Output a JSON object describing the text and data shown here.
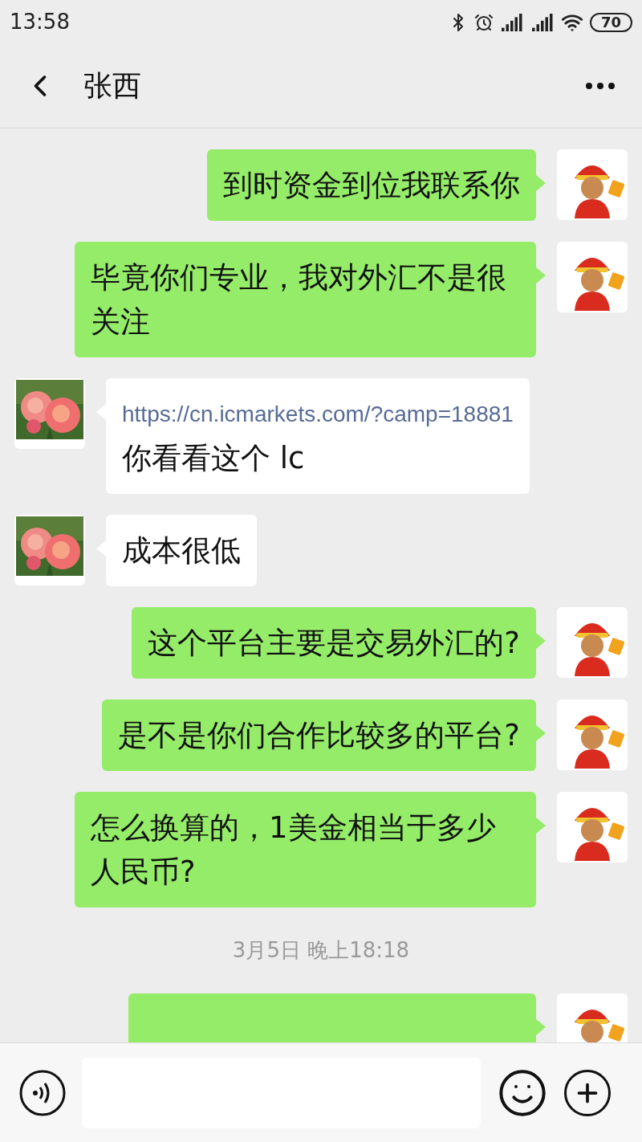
{
  "status_bar": {
    "time": "13:58",
    "battery": "70"
  },
  "header": {
    "title": "张西"
  },
  "messages": [
    {
      "kind": "sent",
      "text": "到时资金到位我联系你"
    },
    {
      "kind": "sent",
      "text": "毕竟你们专业，我对外汇不是很关注"
    },
    {
      "kind": "received",
      "link": "https://cn.icmarkets.com/?camp=18881",
      "text": "你看看这个  lc"
    },
    {
      "kind": "received",
      "text": "成本很低"
    },
    {
      "kind": "sent",
      "text": "这个平台主要是交易外汇的?"
    },
    {
      "kind": "sent",
      "text": "是不是你们合作比较多的平台?"
    },
    {
      "kind": "sent",
      "text": "怎么换算的，1美金相当于多少人民币?"
    },
    {
      "kind": "time",
      "text": "3月5日 晚上18:18"
    },
    {
      "kind": "sent"
    }
  ]
}
